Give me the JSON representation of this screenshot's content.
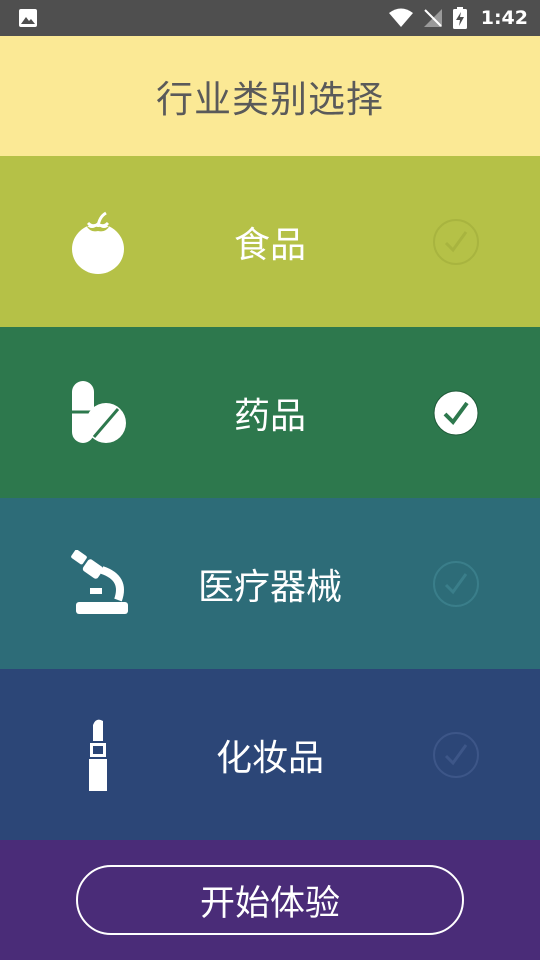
{
  "status_bar": {
    "time": "1:42",
    "icons": [
      "image-icon",
      "wifi-icon",
      "no-signal-icon",
      "battery-charging-icon"
    ]
  },
  "header": {
    "title": "行业类别选择"
  },
  "categories": [
    {
      "label": "食品",
      "icon": "tomato-icon",
      "color": "#b5c147",
      "selected": false
    },
    {
      "label": "药品",
      "icon": "pill-icon",
      "color": "#2d784d",
      "selected": true
    },
    {
      "label": "医疗器械",
      "icon": "microscope-icon",
      "color": "#2d6c78",
      "selected": false
    },
    {
      "label": "化妆品",
      "icon": "lipstick-icon",
      "color": "#2c4677",
      "selected": false
    }
  ],
  "footer": {
    "start_label": "开始体验",
    "color": "#4a2c78"
  }
}
